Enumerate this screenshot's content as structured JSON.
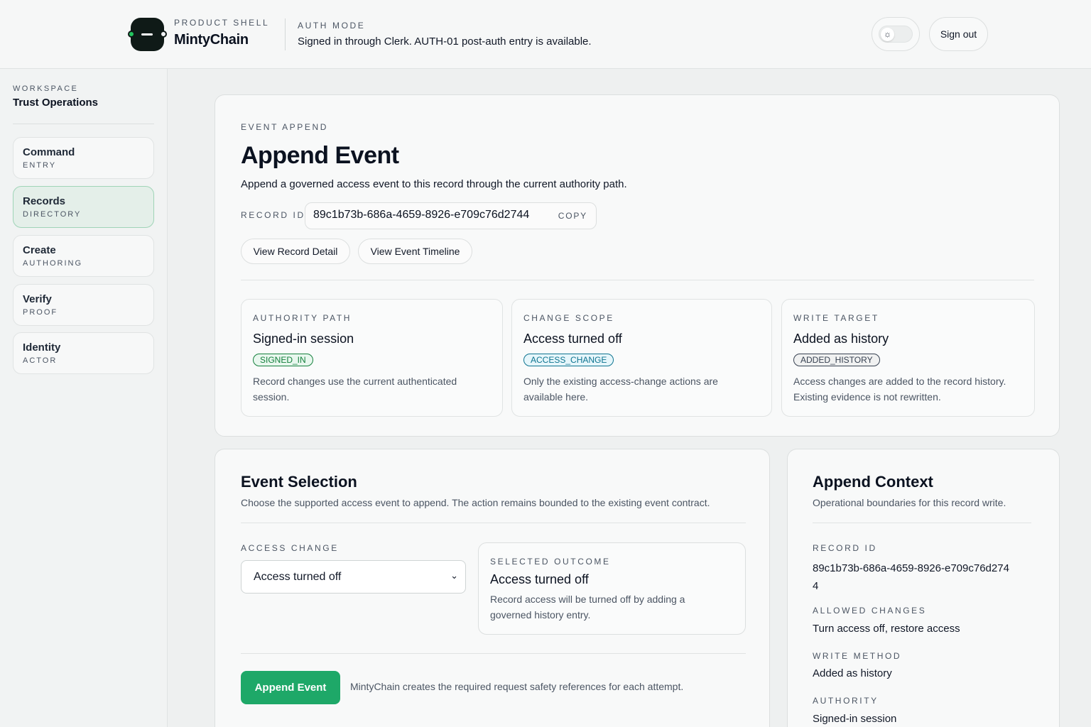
{
  "header": {
    "brand_eyebrow": "PRODUCT SHELL",
    "brand_name": "MintyChain",
    "auth_eyebrow": "AUTH MODE",
    "auth_message": "Signed in through Clerk. AUTH-01 post-auth entry is available.",
    "theme_icon": "sun-icon",
    "sign_out_label": "Sign out"
  },
  "sidebar": {
    "workspace_eyebrow": "WORKSPACE",
    "workspace_name": "Trust Operations",
    "items": [
      {
        "title": "Command",
        "subtitle": "ENTRY",
        "active": false
      },
      {
        "title": "Records",
        "subtitle": "DIRECTORY",
        "active": true
      },
      {
        "title": "Create",
        "subtitle": "AUTHORING",
        "active": false
      },
      {
        "title": "Verify",
        "subtitle": "PROOF",
        "active": false
      },
      {
        "title": "Identity",
        "subtitle": "ACTOR",
        "active": false
      }
    ]
  },
  "main": {
    "eyebrow": "EVENT APPEND",
    "title": "Append Event",
    "description": "Append a governed access event to this record through the current authority path.",
    "record_id_label": "RECORD ID",
    "record_id": "89c1b73b-686a-4659-8926-e709c76d2744",
    "copy_label": "COPY",
    "actions": [
      {
        "label": "View Record Detail"
      },
      {
        "label": "View Event Timeline"
      }
    ],
    "cards": [
      {
        "eyebrow": "AUTHORITY PATH",
        "value": "Signed-in session",
        "badge": "SIGNED_IN",
        "badge_color": "#15803d",
        "desc_1": "Record changes use the current authenticated",
        "desc_2": "session."
      },
      {
        "eyebrow": "CHANGE SCOPE",
        "value": "Access turned off",
        "badge": "ACCESS_CHANGE",
        "badge_color": "#0e7490",
        "desc_1": "Only the existing access-change actions are",
        "desc_2": "available here."
      },
      {
        "eyebrow": "WRITE TARGET",
        "value": "Added as history",
        "badge": "ADDED_HISTORY",
        "badge_color": "#374151",
        "desc_1": "Access changes are added to the record history.",
        "desc_2": "Existing evidence is not rewritten."
      }
    ]
  },
  "event_selection": {
    "title": "Event Selection",
    "description": "Choose the supported access event to append. The action remains bounded to the existing event contract.",
    "access_change_label": "ACCESS CHANGE",
    "access_change_value": "Access turned off",
    "outcome_eyebrow": "SELECTED OUTCOME",
    "outcome_value": "Access turned off",
    "outcome_desc_1": "Record access will be turned off by adding a",
    "outcome_desc_2": "governed history entry.",
    "submit_label": "Append Event",
    "submit_note": "MintyChain creates the required request safety references for each attempt.",
    "accent": "#1ea868"
  },
  "append_context": {
    "title": "Append Context",
    "description": "Operational boundaries for this record write.",
    "record_id_label": "RECORD ID",
    "record_id_line_1": "89c1b73b-686a-4659-8926-e709c76d274",
    "record_id_line_2": "4",
    "allowed_label": "ALLOWED CHANGES",
    "allowed_value": "Turn access off, restore access",
    "write_method_label": "WRITE METHOD",
    "write_method_value": "Added as history",
    "authority_label": "AUTHORITY",
    "authority_value": "Signed-in session"
  }
}
